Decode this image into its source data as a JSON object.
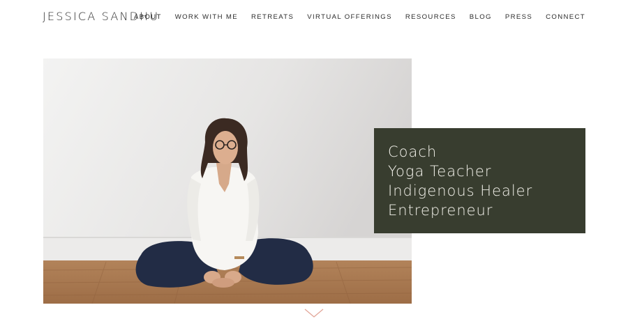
{
  "header": {
    "site_title": "JESSICA SANDHU",
    "nav": [
      {
        "label": "ABOUT",
        "name": "nav-about"
      },
      {
        "label": "WORK WITH ME",
        "name": "nav-work-with-me"
      },
      {
        "label": "RETREATS",
        "name": "nav-retreats"
      },
      {
        "label": "VIRTUAL OFFERINGS",
        "name": "nav-virtual-offerings"
      },
      {
        "label": "RESOURCES",
        "name": "nav-resources"
      },
      {
        "label": "BLOG",
        "name": "nav-blog"
      },
      {
        "label": "PRESS",
        "name": "nav-press"
      },
      {
        "label": "CONNECT",
        "name": "nav-connect"
      }
    ]
  },
  "hero": {
    "roles": [
      "Coach",
      "Yoga Teacher",
      "Indigenous Healer",
      "Entrepreneur"
    ],
    "card_color": "#383d2f",
    "scroll_icon": "chevron-down-icon",
    "scroll_icon_color": "#e3a79a"
  }
}
